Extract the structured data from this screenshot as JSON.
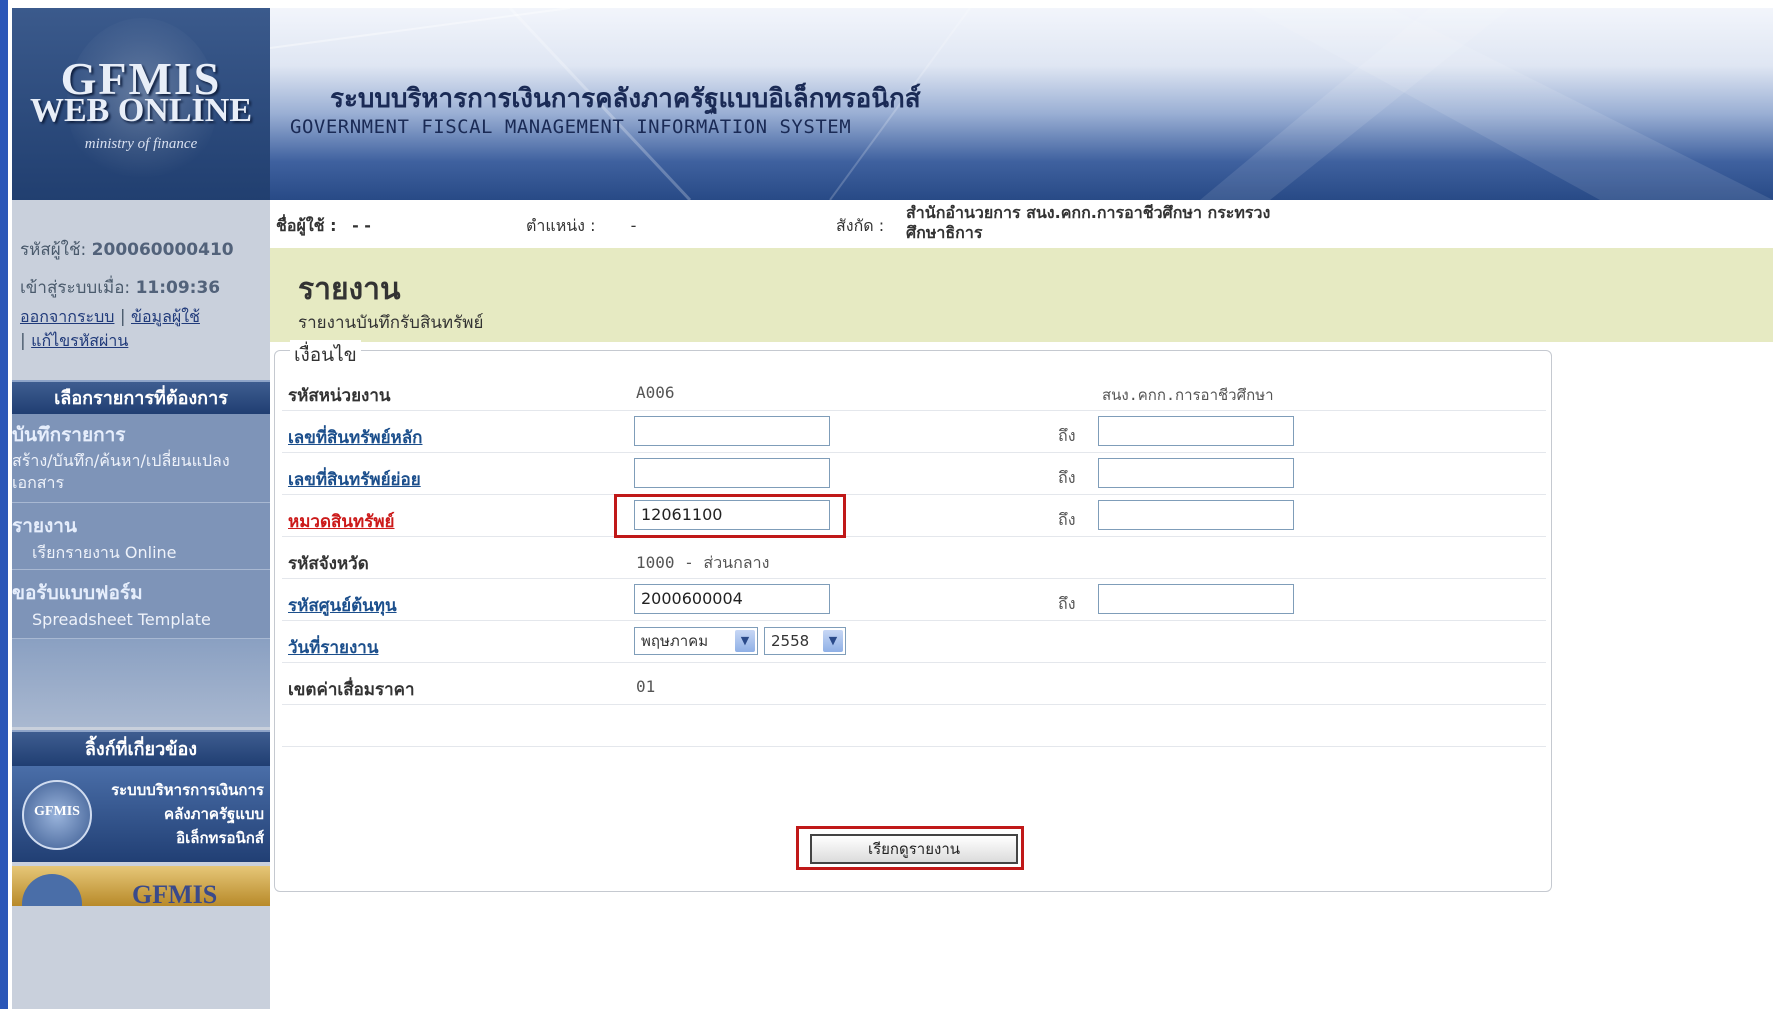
{
  "header": {
    "logo_line1": "GFMIS",
    "logo_line2": "WEB ONLINE",
    "logo_line3": "ministry of finance",
    "title_th": "ระบบบริหารการเงินการคลังภาครัฐแบบอิเล็กทรอนิกส์",
    "title_en": "GOVERNMENT FISCAL MANAGEMENT INFORMATION SYSTEM"
  },
  "sidebar": {
    "user_id_label": "รหัสผู้ใช้:",
    "user_id": "200060000410",
    "login_label": "เข้าสู่ระบบเมื่อ:",
    "login_time": "11:09:36",
    "link_logout": "ออกจากระบบ",
    "link_userinfo": "ข้อมูลผู้ใช้",
    "link_changepw": "แก้ไขรหัสผ่าน",
    "menu_header": "เลือกรายการที่ต้องการ",
    "menu": [
      {
        "title": "บันทึกรายการ",
        "sub": "สร้าง/บันทึก/ค้นหา/เปลี่ยนแปลง เอกสาร"
      },
      {
        "title": "รายงาน",
        "sub": "เรียกรายงาน Online"
      },
      {
        "title": "ขอรับแบบฟอร์ม",
        "sub": "Spreadsheet Template"
      }
    ],
    "related_header": "ลิ้งก์ที่เกี่ยวข้อง",
    "related_banner_text": "ระบบบริหารการเงินการคลังภาครัฐแบบอิเล็กทรอนิกส์",
    "related_banner_logo": "GFMIS",
    "related_banner2_text": "GFMIS"
  },
  "userbar": {
    "username_label": "ชื่อผู้ใช้ :",
    "username_value": "- -",
    "position_label": "ตำแหน่ง :",
    "position_value": "-",
    "affiliation_label": "สังกัด :",
    "affiliation_value_line1": "สำนักอำนวยการ สนง.คกก.การอาชีวศึกษา กระทรวง",
    "affiliation_value_line2": "ศึกษาธิการ"
  },
  "report": {
    "title": "รายงาน",
    "subtitle": "รายงานบันทึกรับสินทรัพย์",
    "legend": "เงื่อนไข"
  },
  "form": {
    "to_label": "ถึง",
    "unit_code_label": "รหัสหน่วยงาน",
    "unit_code_value": "A006",
    "unit_name": "สนง.คกก.การอาชีวศึกษา",
    "asset_main_label": "เลขที่สินทรัพย์หลัก",
    "asset_main_from": "",
    "asset_main_to": "",
    "asset_sub_label": "เลขที่สินทรัพย์ย่อย",
    "asset_sub_from": "",
    "asset_sub_to": "",
    "asset_class_label": "หมวดสินทรัพย์",
    "asset_class_from": "12061100",
    "asset_class_to": "",
    "province_label": "รหัสจังหวัด",
    "province_value": "1000 - ส่วนกลาง",
    "cost_center_label": "รหัสศูนย์ต้นทุน",
    "cost_center_from": "2000600004",
    "cost_center_to": "",
    "report_date_label": "วันที่รายงาน",
    "report_month": "พฤษภาคม",
    "report_year": "2558",
    "depreciation_label": "เขตค่าเสื่อมราคา",
    "depreciation_value": "01",
    "submit_label": "เรียกดูรายงาน"
  },
  "colors": {
    "highlight": "#c01818",
    "title_bg": "#e6eac2",
    "menu_bg": "#7e94b8"
  }
}
